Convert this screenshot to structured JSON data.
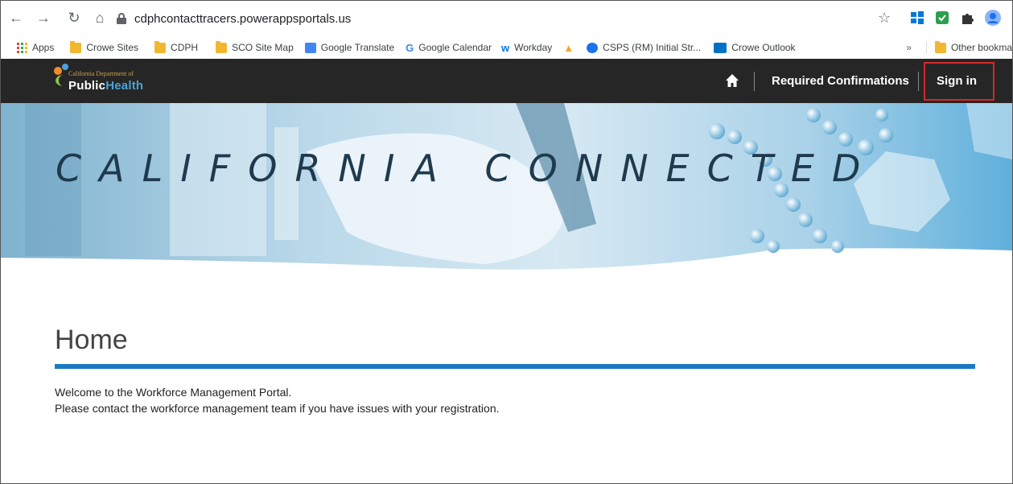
{
  "browser": {
    "url": "cdphcontacttracers.powerappsportals.us",
    "bookmarks": [
      {
        "label": "Apps",
        "icon": "apps-grid-icon"
      },
      {
        "label": "Crowe Sites",
        "icon": "folder-icon"
      },
      {
        "label": "CDPH",
        "icon": "folder-icon"
      },
      {
        "label": "SCO Site Map",
        "icon": "folder-icon"
      },
      {
        "label": "Google Translate",
        "icon": "google-translate-icon"
      },
      {
        "label": "Google Calendar",
        "icon": "google-icon"
      },
      {
        "label": "Workday",
        "icon": "workday-icon"
      },
      {
        "label": "",
        "icon": "triangle-icon"
      },
      {
        "label": "CSPS (RM) Initial Str...",
        "icon": "csps-icon"
      },
      {
        "label": "Crowe Outlook",
        "icon": "outlook-icon"
      }
    ],
    "overflow_label": "»",
    "other_bookmarks": "Other bookma"
  },
  "site": {
    "logo": {
      "dept": "California Department of",
      "name_public": "Public",
      "name_health": "Health"
    },
    "nav": {
      "required_confirmations": "Required Confirmations",
      "sign_in": "Sign in"
    },
    "banner_title": "CALIFORNIA CONNECTED"
  },
  "main": {
    "title": "Home",
    "welcome_line1": "Welcome to the Workforce Management Portal.",
    "welcome_line2": "Please contact the workforce management team if you have issues with your registration."
  },
  "colors": {
    "header_bg": "#262626",
    "accent_blue": "#1a7bc4",
    "highlight_red": "#d62828"
  }
}
